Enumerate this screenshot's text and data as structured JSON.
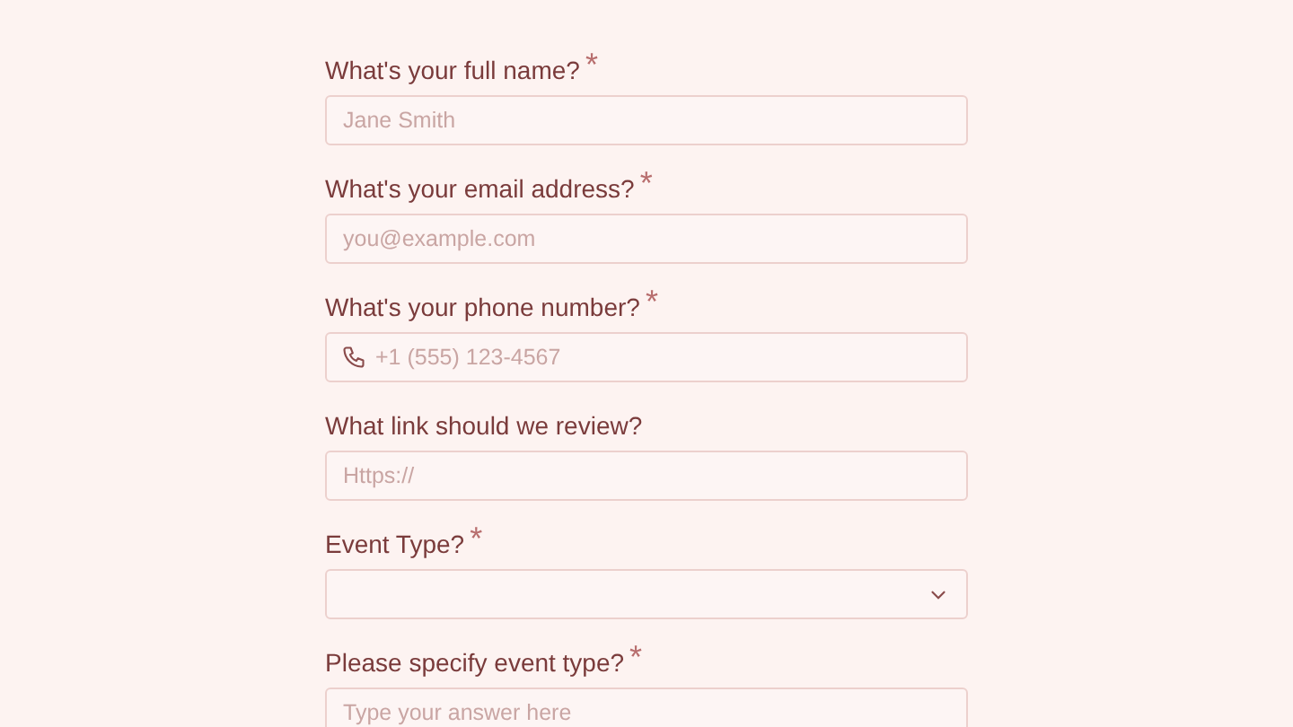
{
  "fields": [
    {
      "kind": "text",
      "label": "What's your full name?",
      "required_mark": "*",
      "placeholder": "Jane Smith"
    },
    {
      "kind": "text",
      "label": "What's your email address?",
      "required_mark": "*",
      "placeholder": "you@example.com"
    },
    {
      "kind": "phone",
      "label": "What's your phone number?",
      "required_mark": "*",
      "placeholder": "+1 (555) 123-4567"
    },
    {
      "kind": "text",
      "label": "What link should we review?",
      "placeholder": "Https://"
    },
    {
      "kind": "select",
      "label": "Event Type?",
      "required_mark": "*"
    },
    {
      "kind": "text",
      "label": "Please specify event type?",
      "required_mark": "*",
      "placeholder": "Type your answer here"
    }
  ]
}
